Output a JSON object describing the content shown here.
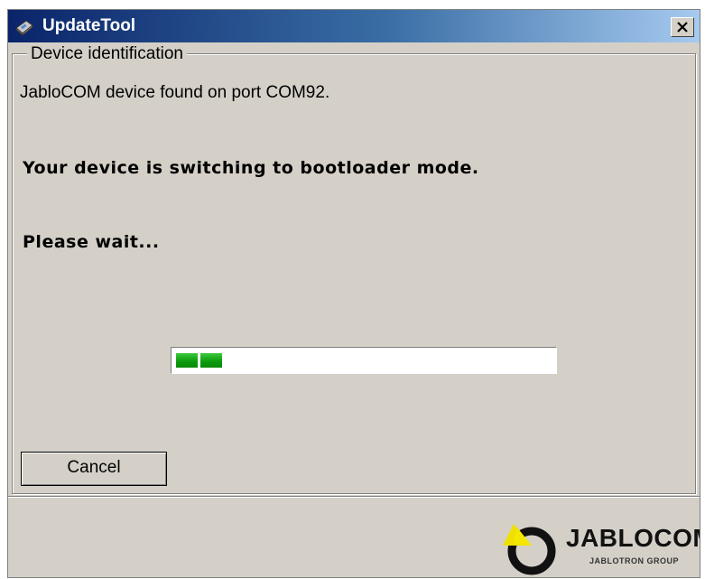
{
  "window": {
    "title": "UpdateTool"
  },
  "group": {
    "label": "Device identification",
    "found_text": "JabloCOM device found on port COM92.",
    "switching_text": "Your device is switching to bootloader mode.",
    "wait_text": "Please wait..."
  },
  "progress": {
    "filled_segments": 2,
    "color": "#10a010"
  },
  "buttons": {
    "cancel": "Cancel"
  },
  "branding": {
    "name": "JABLOCOM",
    "sub": "JABLOTRON GROUP",
    "accent": "#f0e000"
  }
}
